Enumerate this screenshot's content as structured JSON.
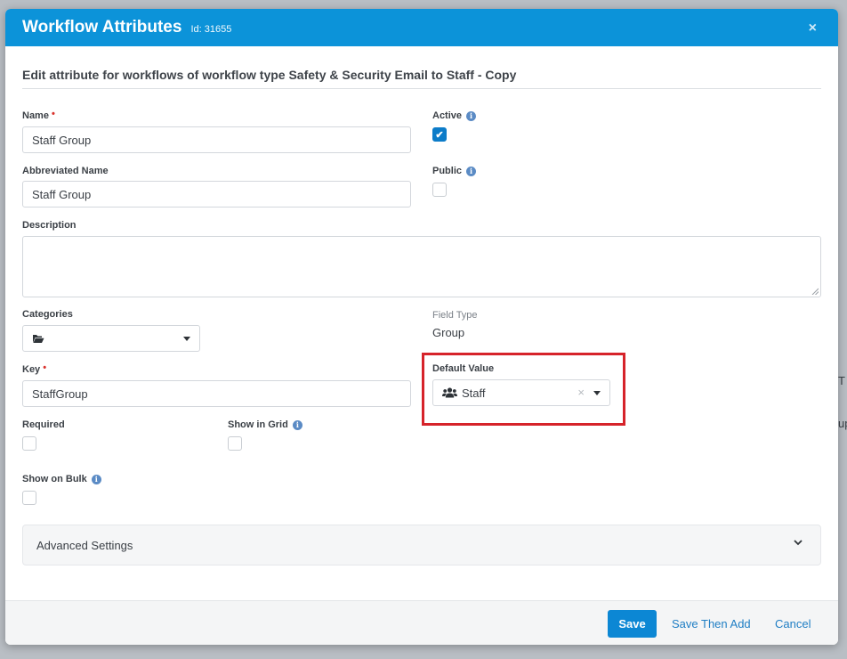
{
  "background": {
    "frag1": "T",
    "frag2": "up"
  },
  "modal": {
    "title": "Workflow Attributes",
    "id_label": "Id: 31655",
    "close_glyph": "×",
    "subtitle": "Edit attribute for workflows of workflow type Safety & Security Email to Staff - Copy"
  },
  "form": {
    "name": {
      "label": "Name",
      "value": "Staff Group"
    },
    "abbreviated_name": {
      "label": "Abbreviated Name",
      "value": "Staff Group"
    },
    "active": {
      "label": "Active",
      "checked": true
    },
    "public": {
      "label": "Public",
      "checked": false
    },
    "description": {
      "label": "Description",
      "value": ""
    },
    "categories": {
      "label": "Categories",
      "value": ""
    },
    "field_type": {
      "label": "Field Type",
      "value": "Group"
    },
    "key": {
      "label": "Key",
      "value": "StaffGroup"
    },
    "default_value": {
      "label": "Default Value",
      "value": "Staff",
      "clear_glyph": "×"
    },
    "required": {
      "label": "Required",
      "checked": false
    },
    "show_in_grid": {
      "label": "Show in Grid",
      "checked": false
    },
    "show_on_bulk": {
      "label": "Show on Bulk",
      "checked": false
    },
    "required_marker": "•",
    "info_glyph": "i",
    "check_glyph": "✔"
  },
  "advanced": {
    "label": "Advanced Settings"
  },
  "footer": {
    "save": "Save",
    "save_then_add": "Save Then Add",
    "cancel": "Cancel"
  },
  "colors": {
    "header": "#0c93d9",
    "primary": "#0c87d4",
    "link": "#1f7ec4",
    "highlight": "#d6232a",
    "required": "#d9312b"
  },
  "icons": {
    "categories": "folder-open-icon",
    "default_value": "users-icon",
    "accordion": "chevron-down-icon"
  }
}
